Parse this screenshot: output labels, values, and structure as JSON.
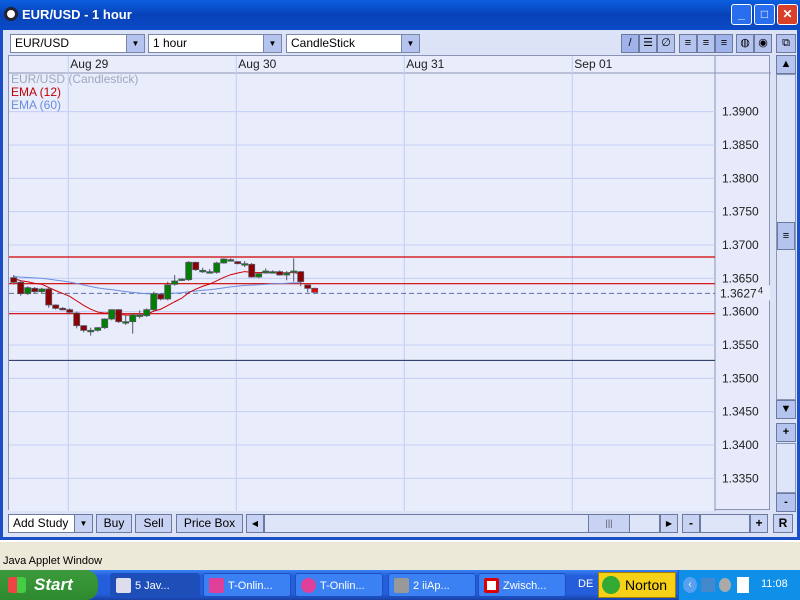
{
  "window": {
    "title": "EUR/USD - 1 hour",
    "minimize": "_",
    "maximize": "□",
    "close": "✕"
  },
  "toolbar": {
    "symbol": "EUR/USD",
    "interval": "1 hour",
    "chart_type": "CandleStick",
    "tool_icons": [
      "line-tool-icon",
      "hlines-tool-icon",
      "no-tool-icon",
      "grid-1-icon",
      "grid-2-icon",
      "grid-3-icon",
      "color-scheme-1-icon",
      "color-scheme-2-icon",
      "detach-icon"
    ]
  },
  "legend": {
    "series": "EUR/USD (Candlestick)",
    "ema12": "EMA (12)",
    "ema60": "EMA (60)"
  },
  "colors": {
    "up": "#008000",
    "down": "#8b0000",
    "ema12": "#cc0000",
    "ema60": "#6a8ee0",
    "level": "#d00000",
    "grid": "#c3cff5"
  },
  "chart_data": {
    "type": "candlestick",
    "ylim": [
      1.3301,
      1.3958
    ],
    "y_ticks": [
      "1.3900",
      "1.3850",
      "1.3800",
      "1.3750",
      "1.3700",
      "1.3650",
      "1.3600",
      "1.3550",
      "1.3500",
      "1.3450",
      "1.3400",
      "1.3350"
    ],
    "x_ticks": [
      {
        "label": "Aug 29",
        "bar": 7.8
      },
      {
        "label": "Aug 30",
        "bar": 31.8
      },
      {
        "label": "Aug 31",
        "bar": 55.8
      },
      {
        "label": "Sep 01",
        "bar": 79.8
      }
    ],
    "visible_bars": 101,
    "candles": [
      [
        1.3651,
        1.3655,
        1.3641,
        1.3644
      ],
      [
        1.3644,
        1.3647,
        1.3624,
        1.3627
      ],
      [
        1.3627,
        1.3638,
        1.3625,
        1.3636
      ],
      [
        1.3635,
        1.3637,
        1.3628,
        1.363
      ],
      [
        1.363,
        1.3636,
        1.3628,
        1.3634
      ],
      [
        1.3634,
        1.3636,
        1.3606,
        1.361
      ],
      [
        1.361,
        1.3611,
        1.3603,
        1.3605
      ],
      [
        1.3605,
        1.3607,
        1.3603,
        1.3604
      ],
      [
        1.3603,
        1.3605,
        1.3597,
        1.3599
      ],
      [
        1.3598,
        1.36,
        1.3575,
        1.3579
      ],
      [
        1.3579,
        1.358,
        1.3569,
        1.3572
      ],
      [
        1.3572,
        1.3576,
        1.3564,
        1.3572
      ],
      [
        1.3572,
        1.3577,
        1.357,
        1.3576
      ],
      [
        1.3576,
        1.359,
        1.3574,
        1.3589
      ],
      [
        1.3589,
        1.36,
        1.3587,
        1.3603
      ],
      [
        1.3603,
        1.3604,
        1.3583,
        1.3585
      ],
      [
        1.3585,
        1.3595,
        1.358,
        1.3585
      ],
      [
        1.3585,
        1.3597,
        1.3567,
        1.3595
      ],
      [
        1.3595,
        1.3602,
        1.359,
        1.3595
      ],
      [
        1.3594,
        1.3605,
        1.3592,
        1.3603
      ],
      [
        1.3603,
        1.363,
        1.3601,
        1.3627
      ],
      [
        1.3626,
        1.3628,
        1.3617,
        1.3619
      ],
      [
        1.3619,
        1.3645,
        1.3617,
        1.364
      ],
      [
        1.3641,
        1.3655,
        1.3639,
        1.3646
      ],
      [
        1.3648,
        1.365,
        1.3646,
        1.3649
      ],
      [
        1.3648,
        1.3676,
        1.3646,
        1.3674
      ],
      [
        1.3674,
        1.3675,
        1.3661,
        1.3663
      ],
      [
        1.3662,
        1.3666,
        1.3658,
        1.3662
      ],
      [
        1.366,
        1.3664,
        1.3658,
        1.366
      ],
      [
        1.3659,
        1.3675,
        1.3657,
        1.3673
      ],
      [
        1.3673,
        1.368,
        1.3672,
        1.3679
      ],
      [
        1.3678,
        1.368,
        1.3676,
        1.3678
      ],
      [
        1.3675,
        1.3676,
        1.3671,
        1.3672
      ],
      [
        1.3672,
        1.3676,
        1.3667,
        1.3672
      ],
      [
        1.3671,
        1.3673,
        1.3651,
        1.3652
      ],
      [
        1.3652,
        1.3658,
        1.365,
        1.3657
      ],
      [
        1.3658,
        1.3665,
        1.3657,
        1.3661
      ],
      [
        1.366,
        1.3662,
        1.3658,
        1.366
      ],
      [
        1.366,
        1.3662,
        1.3654,
        1.3655
      ],
      [
        1.3655,
        1.3661,
        1.3647,
        1.3658
      ],
      [
        1.3661,
        1.368,
        1.3645,
        1.3661
      ],
      [
        1.366,
        1.3661,
        1.3638,
        1.3645
      ],
      [
        1.364,
        1.3641,
        1.3629,
        1.3635
      ],
      [
        1.3635,
        1.3636,
        1.3629,
        1.3629
      ]
    ],
    "ema12_seed": 1.3651,
    "ema60_seed": 1.3653,
    "levels": [
      1.3682,
      1.3642,
      1.3597
    ],
    "support_line": 1.3527,
    "current_price": 1.36274,
    "current_price_label": "1.3627",
    "current_price_suffix": "4"
  },
  "bottom": {
    "add_study": "Add Study",
    "buy": "Buy",
    "sell": "Sell",
    "price_box": "Price Box",
    "zoom_out": "-",
    "zoom_in": "+",
    "reset": "R",
    "scroll_grip": "|||"
  },
  "status": "Java Applet Window",
  "taskbar": {
    "start": "Start",
    "tasks": [
      "5 Jav...",
      "T-Onlin...",
      "T-Onlin...",
      "2 iiAp...",
      "Zwisch..."
    ],
    "lang": "DE",
    "norton": "Norton",
    "clock": "11:08"
  }
}
